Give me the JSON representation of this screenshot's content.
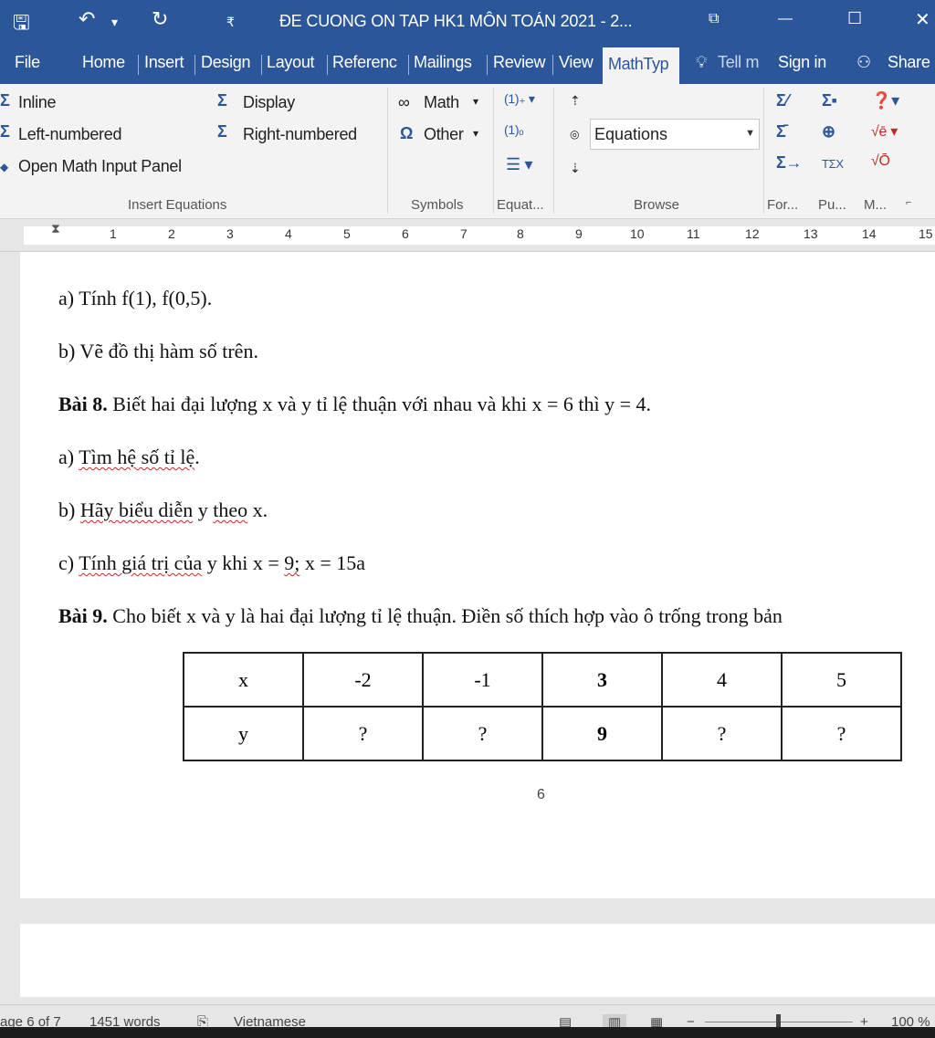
{
  "window": {
    "title": "ĐE CUONG ON TAP HK1 MÔN TOÁN 2021 - 2...",
    "qat_customize_glyph": "₹",
    "controls": {
      "minimize": "—",
      "maximize": "☐",
      "close": "✕"
    }
  },
  "menu": {
    "tabs": [
      "File",
      "Home",
      "Insert",
      "Design",
      "Layout",
      "Referenc",
      "Mailings",
      "Review",
      "View",
      "MathTyp"
    ],
    "tell_me": "Tell m",
    "sign_in": "Sign in",
    "share": "Share"
  },
  "ribbon": {
    "insert_equations": {
      "inline": "Inline",
      "display": "Display",
      "left_numbered": "Left-numbered",
      "right_numbered": "Right-numbered",
      "open_panel": "Open Math Input Panel",
      "label": "Insert Equations"
    },
    "symbols": {
      "math": "Math",
      "other": "Other",
      "label": "Symbols"
    },
    "equation_numbers": {
      "label": "Equat..."
    },
    "browse": {
      "select_value": "Equations",
      "label": "Browse"
    },
    "format": {
      "label": "For..."
    },
    "publish": {
      "label": "Pu..."
    },
    "mathtype": {
      "label": "M..."
    }
  },
  "ruler": {
    "numbers": [
      "1",
      "2",
      "3",
      "4",
      "5",
      "6",
      "7",
      "8",
      "9",
      "10",
      "11",
      "12",
      "13",
      "14",
      "15"
    ]
  },
  "document": {
    "lines": {
      "l1": "a) Tính f(1), f(0,5).",
      "l2": "b) Vẽ đồ thị hàm số trên.",
      "bai8_label": "Bài 8.",
      "bai8_text": " Biết hai đại lượng x và y tỉ lệ thuận với nhau và khi x = 6 thì y = 4.",
      "l4_prefix": "a) ",
      "l4_words": "Tìm hệ số tỉ lệ",
      "l4_suffix": ".",
      "l5_prefix": "b) ",
      "l5_w1": "Hãy biểu diễn",
      "l5_mid": " y ",
      "l5_w2": "theo",
      "l5_suffix": " x.",
      "l6_prefix": "c) ",
      "l6_words": "Tính giá trị của",
      "l6_mid": " y khi x = ",
      "l6_nine": "9;",
      "l6_suffix": " x = 15a",
      "bai9_label": "Bài 9.",
      "bai9_text": " Cho biết x và y là hai đại lượng tỉ lệ thuận. Điền số thích hợp vào ô trống trong bản"
    },
    "table": {
      "rows": [
        [
          "x",
          "-2",
          "-1",
          "3",
          "4",
          "5"
        ],
        [
          "y",
          "?",
          "?",
          "9",
          "?",
          "?"
        ]
      ]
    },
    "page_number": "6"
  },
  "status": {
    "page": "age 6 of 7",
    "words": "1451 words",
    "language": "Vietnamese",
    "zoom": "100 %"
  }
}
